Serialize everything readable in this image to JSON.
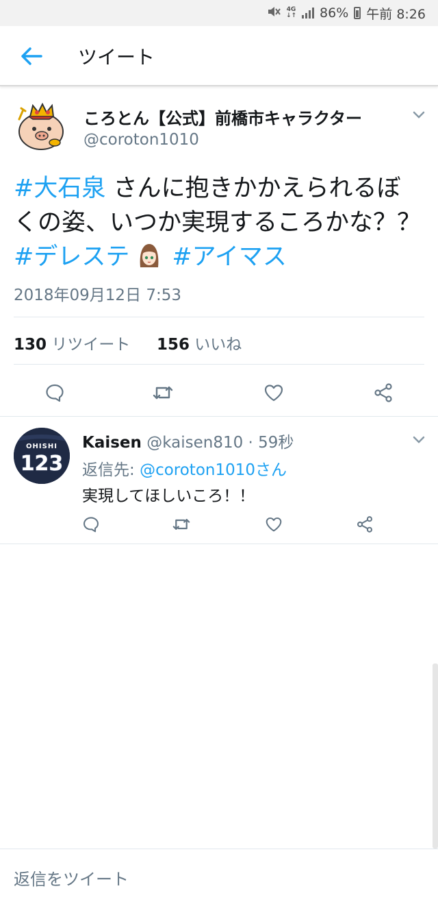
{
  "status_bar": {
    "network": "4G",
    "battery_percent": "86%",
    "time": "午前 8:26",
    "icons": [
      "mute-icon",
      "network-4g-icon",
      "signal-icon",
      "battery-icon"
    ]
  },
  "header": {
    "title": "ツイート",
    "back_icon": "back-arrow-icon"
  },
  "tweet": {
    "author_name": "ころとん【公式】前橋市キャラクター",
    "author_handle": "@coroton1010",
    "text_segments": {
      "hashtag1": "#大石泉",
      "part1": " さんに抱きかかえられるぼくの姿、いつか実現するころかな？？",
      "hashtag2": "#デレステ",
      "hashtag3": "#アイマス"
    },
    "timestamp": "2018年09月12日 7:53",
    "retweet_count": "130",
    "retweet_label": "リツイート",
    "like_count": "156",
    "like_label": "いいね",
    "actions": [
      "reply-icon",
      "retweet-icon",
      "like-icon",
      "share-icon"
    ]
  },
  "reply": {
    "name": "Kaisen",
    "handle": "@kaisen810",
    "separator": " · ",
    "time": "59秒",
    "reply_to_label": "返信先: ",
    "reply_to_mention": "@coroton1010さん",
    "text": "実現してほしいころ！！",
    "avatar_text_top": "OHISHI",
    "avatar_text_number": "123"
  },
  "compose": {
    "placeholder": "返信をツイート"
  },
  "colors": {
    "accent": "#1da1f2",
    "text_primary": "#14171a",
    "text_secondary": "#657786",
    "divider": "#e1e8ed"
  }
}
